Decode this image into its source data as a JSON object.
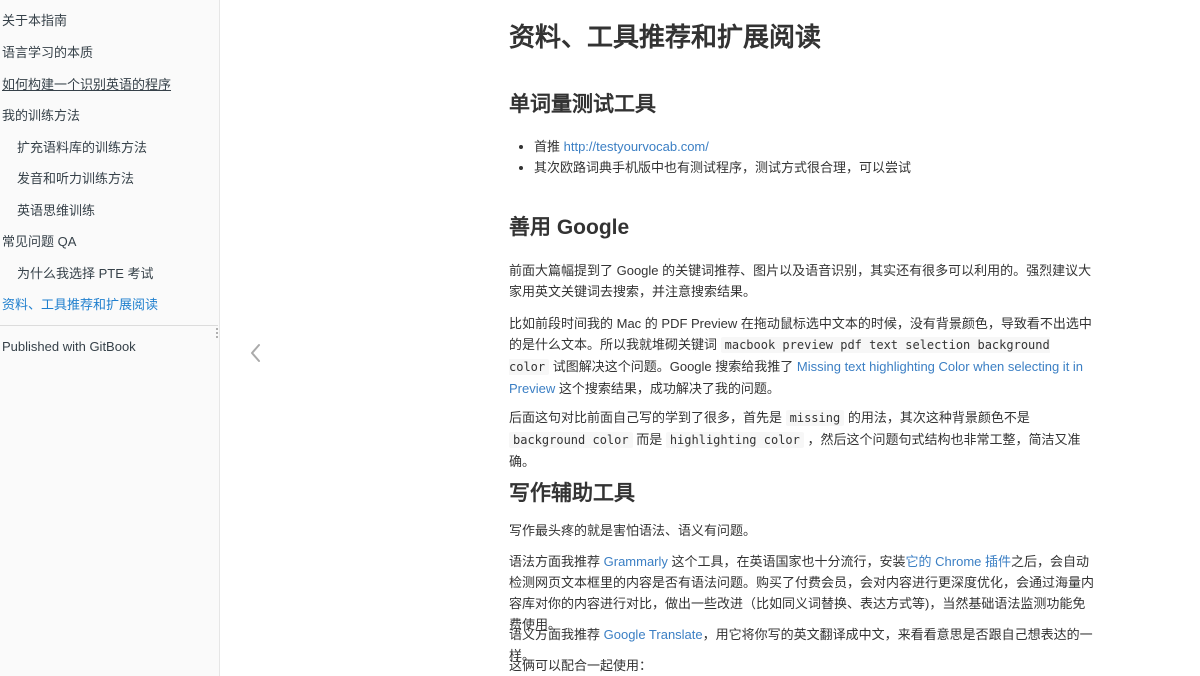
{
  "sidebar": {
    "items": [
      {
        "label": "关于本指南"
      },
      {
        "label": "语言学习的本质"
      },
      {
        "label": "如何构建一个识别英语的程序"
      },
      {
        "label": "我的训练方法"
      },
      {
        "label": "扩充语料库的训练方法"
      },
      {
        "label": "发音和听力训练方法"
      },
      {
        "label": "英语思维训练"
      },
      {
        "label": "常见问题 QA"
      },
      {
        "label": "为什么我选择 PTE 考试"
      },
      {
        "label": "资料、工具推荐和扩展阅读"
      }
    ],
    "published": "Published with GitBook",
    "active_color": "#1f7fce"
  },
  "content": {
    "title": "资料、工具推荐和扩展阅读",
    "sec1": {
      "heading": "单词量测试工具",
      "b1_prefix": "首推 ",
      "b1_link": "http://testyourvocab.com/",
      "b2": "其次欧路词典手机版中也有测试程序，测试方式很合理，可以尝试"
    },
    "sec2": {
      "heading": "善用 Google",
      "p1": "前面大篇幅提到了 Google 的关键词推荐、图片以及语音识别，其实还有很多可以利用的。强烈建议大家用英文关键词去搜索，并注意搜索结果。",
      "p2_a": "比如前段时间我的 Mac 的 PDF Preview 在拖动鼠标选中文本的时候，没有背景颜色，导致看不出选中的是什么文本。所以我就堆砌关键词 ",
      "p2_code": "macbook preview pdf text selection background color",
      "p2_b": " 试图解决这个问题。Google 搜索给我推了 ",
      "p2_link": "Missing text highlighting Color when selecting it in Preview",
      "p2_c": " 这个搜索结果，成功解决了我的问题。",
      "p3_a": "后面这句对比前面自己写的学到了很多，首先是 ",
      "p3_code1": "missing",
      "p3_b": " 的用法，其次这种背景颜色不是 ",
      "p3_code2": "background color",
      "p3_c": " 而是 ",
      "p3_code3": "highlighting color",
      "p3_d": " ，然后这个问题句式结构也非常工整，简洁又准确。"
    },
    "sec3": {
      "heading": "写作辅助工具",
      "p1": "写作最头疼的就是害怕语法、语义有问题。",
      "p2_a": "语法方面我推荐 ",
      "p2_link1": "Grammarly",
      "p2_b": " 这个工具，在英语国家也十分流行，安装",
      "p2_link2": "它的 Chrome 插件",
      "p2_c": "之后，会自动检测网页文本框里的内容是否有语法问题。购买了付费会员，会对内容进行更深度优化，会通过海量内容库对你的内容进行对比，做出一些改进（比如同义词替换、表达方式等)，当然基础语法监测功能免费使用。",
      "p3_a": "语义方面我推荐 ",
      "p3_link": "Google Translate",
      "p3_b": "，用它将你写的英文翻译成中文，来看看意思是否跟自己想表达的一样。",
      "p4": "这俩可以配合一起使用："
    },
    "link_color": "#3b7fc4"
  },
  "icons": {
    "prev": "chevron-left-icon",
    "resize": "drag-handle-icon"
  }
}
